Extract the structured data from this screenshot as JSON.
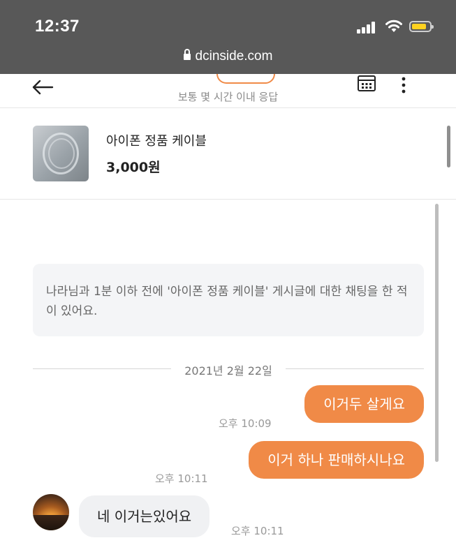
{
  "status_bar": {
    "time": "12:37"
  },
  "browser": {
    "url": "dcinside.com"
  },
  "header": {
    "subtitle": "보통 몇 시간 이내 응답"
  },
  "product": {
    "name": "아이폰 정품 케이블",
    "price": "3,000원"
  },
  "notice": {
    "text": "나라님과 1분 이하 전에 '아이폰 정품 케이블' 게시글에 대한 채팅을 한 적이 있어요."
  },
  "date_divider": "2021년 2월 22일",
  "messages": [
    {
      "direction": "out",
      "text": "이거두 살게요",
      "time": "오후 10:09"
    },
    {
      "direction": "out",
      "text": "이거 하나 판매하시나요",
      "time": "오후 10:11"
    },
    {
      "direction": "in",
      "text": "네 이거는있어요",
      "time": "오후 10:11"
    }
  ],
  "colors": {
    "accent": "#f08a47",
    "overlay": "#585858",
    "battery": "#ffd21f"
  },
  "icons": [
    "back-arrow-icon",
    "calendar-icon",
    "more-vertical-icon",
    "lock-icon",
    "signal-icon",
    "wifi-icon",
    "battery-icon"
  ]
}
